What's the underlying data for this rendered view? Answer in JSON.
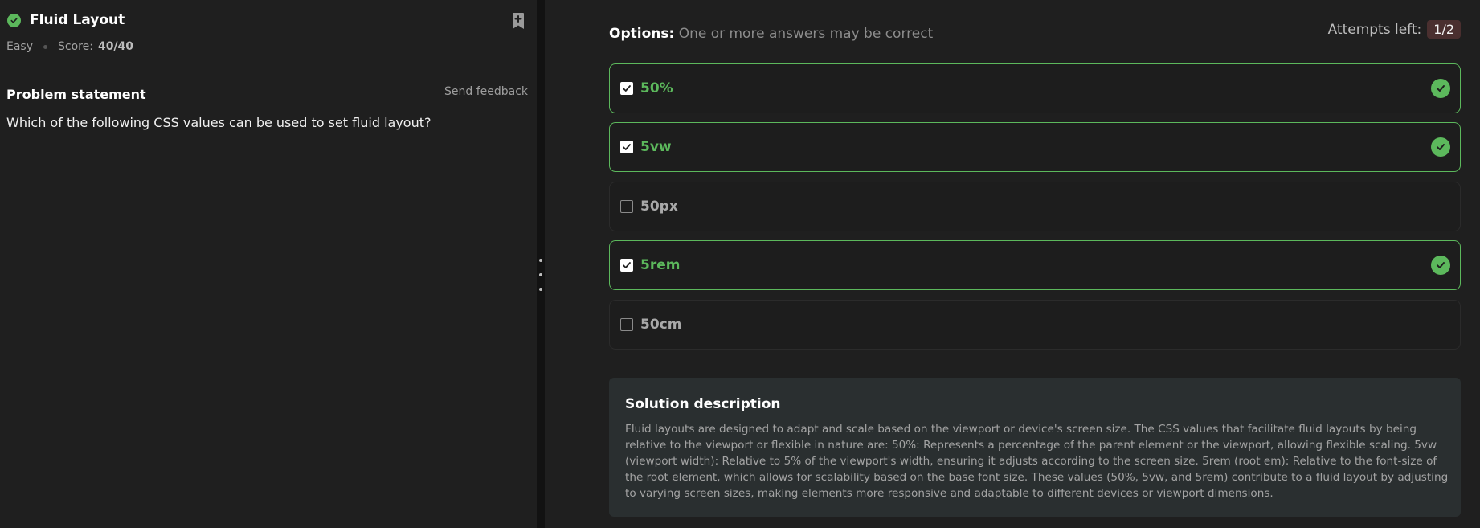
{
  "problem": {
    "title": "Fluid Layout",
    "difficulty": "Easy",
    "score_label": "Score:",
    "score_value": "40/40",
    "statement_heading": "Problem statement",
    "feedback_link": "Send feedback",
    "question": "Which of the following CSS values can be used to set fluid layout?"
  },
  "options_panel": {
    "label": "Options:",
    "hint": "One or more answers may be correct",
    "attempts_label": "Attempts left:",
    "attempts_value": "1/2",
    "options": [
      {
        "label": "50%",
        "checked": true,
        "correct": true
      },
      {
        "label": "5vw",
        "checked": true,
        "correct": true
      },
      {
        "label": "50px",
        "checked": false,
        "correct": false
      },
      {
        "label": "5rem",
        "checked": true,
        "correct": true
      },
      {
        "label": "50cm",
        "checked": false,
        "correct": false
      }
    ]
  },
  "solution": {
    "title": "Solution description",
    "body": "Fluid layouts are designed to adapt and scale based on the viewport or device's screen size. The CSS values that facilitate fluid layouts by being relative to the viewport or flexible in nature are: 50%: Represents a percentage of the parent element or the viewport, allowing flexible scaling. 5vw (viewport width): Relative to 5% of the viewport's width, ensuring it adjusts according to the screen size. 5rem (root em): Relative to the font-size of the root element, which allows for scalability based on the base font size. These values (50%, 5vw, and 5rem) contribute to a fluid layout by adjusting to varying screen sizes, making elements more responsive and adaptable to different devices or viewport dimensions."
  },
  "colors": {
    "accent_green": "#5cb85c",
    "attempts_badge_bg": "#4a2f2f",
    "solution_bg": "#2a2f30"
  },
  "icons": {
    "status": "check-circle-icon",
    "bookmark": "bookmark-plus-icon",
    "correct": "check-circle-icon",
    "checkbox": "checkbox-icon",
    "divider": "drag-handle-icon"
  }
}
